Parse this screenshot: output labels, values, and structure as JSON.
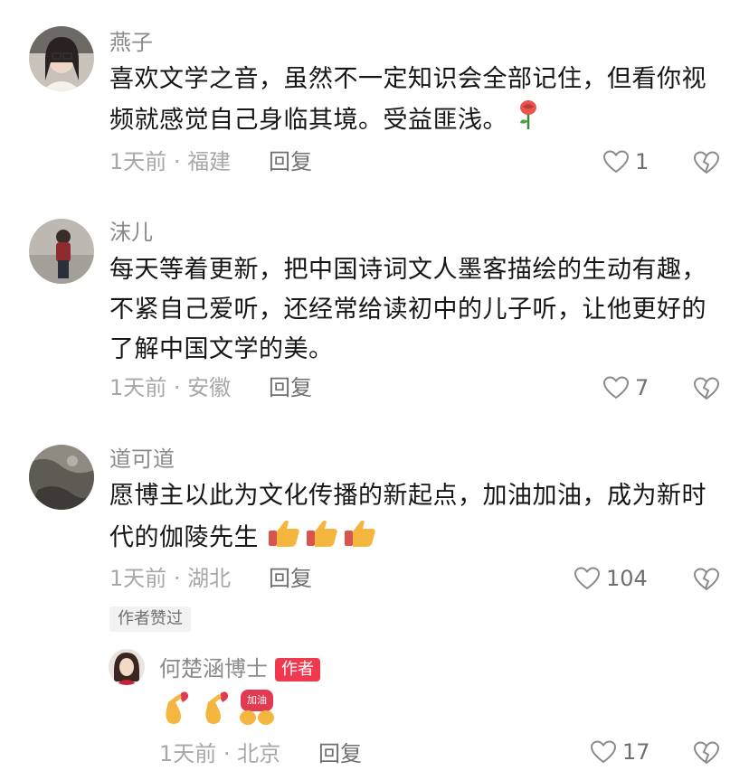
{
  "comments": [
    {
      "username": "燕子",
      "text": "喜欢文学之音，虽然不一定知识会全部记住，但看你视频就感觉自己身临其境。受益匪浅。",
      "time": "1天前",
      "location": "福建",
      "reply_label": "回复",
      "likes": "1",
      "emoji": "rose-emoji"
    },
    {
      "username": "沫儿",
      "text": "每天等着更新，把中国诗词文人墨客描绘的生动有趣，不紧自己爱听，还经常给读初中的儿子听，让他更好的了解中国文学的美。",
      "time": "1天前",
      "location": "安徽",
      "reply_label": "回复",
      "likes": "7"
    },
    {
      "username": "道可道",
      "text": "愿博主以此为文化传播的新起点，加油加油，成为新时代的伽陵先生",
      "time": "1天前",
      "location": "湖北",
      "reply_label": "回复",
      "likes": "104",
      "badge": "作者赞过",
      "emoji": "thumbs-up-emoji"
    }
  ],
  "author_reply": {
    "username": "何楚涵博士",
    "tag": "作者",
    "emoji_text": "加油",
    "time": "1天前",
    "location": "北京",
    "reply_label": "回复",
    "likes": "17"
  },
  "colors": {
    "author_tag": "#f0384f",
    "text": "#161616",
    "meta": "#a8a8a8"
  }
}
